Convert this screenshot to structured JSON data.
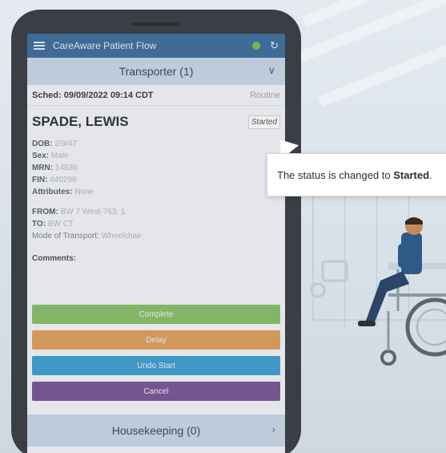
{
  "app": {
    "title": "CareAware Patient Flow"
  },
  "transporter_section": {
    "label": "Transporter (1)"
  },
  "task": {
    "sched_label": "Sched: 09/09/2022 09:14 CDT",
    "priority": "Routine",
    "patient_name": "SPADE, LEWIS",
    "status": "Started",
    "dob_label": "DOB:",
    "dob": "2/9/47",
    "sex_label": "Sex:",
    "sex": "Male",
    "mrn_label": "MRN:",
    "mrn": "14836",
    "fin_label": "FIN:",
    "fin": "440298",
    "attributes_label": "Attributes:",
    "attributes": "None",
    "from_label": "FROM:",
    "from": "BW 7 West-763, 1",
    "to_label": "TO:",
    "to": "BW CT",
    "transport_mode_label": "Mode of Transport:",
    "transport_mode": "Wheelchair",
    "comments_label": "Comments:"
  },
  "buttons": {
    "complete": "Complete",
    "delay": "Delay",
    "undo_start": "Undo Start",
    "cancel": "Cancel"
  },
  "housekeeping_section": {
    "label": "Housekeeping (0)"
  },
  "callout": {
    "text_prefix": "The status is changed to ",
    "text_bold": "Started",
    "text_suffix": "."
  },
  "colors": {
    "app_bar": "#3f6f9d",
    "status_online": "#77c34b",
    "complete": "#89bf6a",
    "delay": "#dea05e",
    "undo_start": "#3e9fd0",
    "cancel": "#7a5796"
  }
}
